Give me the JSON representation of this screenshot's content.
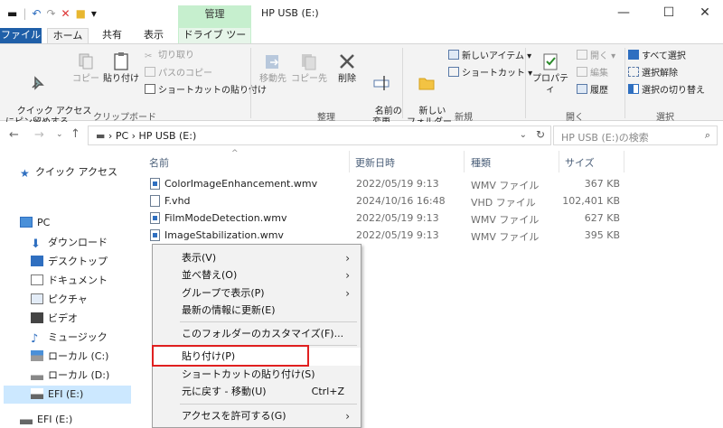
{
  "window": {
    "title": "HP USB (E:)",
    "context_tab": "管理",
    "controls": {
      "minimize": "—",
      "maximize": "☐",
      "close": "✕"
    }
  },
  "ribbon_tabs": [
    "ファイル",
    "ホーム",
    "共有",
    "表示",
    "ドライブ ツール"
  ],
  "ribbon": {
    "clipboard": {
      "pin": "クイック アクセス\nにピン留めする",
      "copy": "コピー",
      "paste": "貼り付け",
      "cut": "切り取り",
      "copy_path": "パスのコピー",
      "paste_shortcut": "ショートカットの貼り付け",
      "title": "クリップボード"
    },
    "organize": {
      "move_to": "移動先",
      "copy_to": "コピー先",
      "delete": "削除",
      "rename": "名前の\n変更",
      "title": "整理"
    },
    "new": {
      "new_folder": "新しい\nフォルダー",
      "new_item": "新しいアイテム ▾",
      "shortcut": "ショートカット ▾",
      "title": "新規"
    },
    "open": {
      "properties": "プロパティ",
      "open": "開く ▾",
      "edit": "編集",
      "history": "履歴",
      "title": "開く"
    },
    "select": {
      "select_all": "すべて選択",
      "select_none": "選択解除",
      "invert": "選択の切り替え",
      "title": "選択"
    }
  },
  "address": {
    "breadcrumb": "PC  ›  HP USB (E:)",
    "search_placeholder": "HP USB (E:)の検索"
  },
  "nav": {
    "quick_access": "クイック アクセス",
    "pc": "PC",
    "items": [
      "ダウンロード",
      "デスクトップ",
      "ドキュメント",
      "ピクチャ",
      "ビデオ",
      "ミュージック",
      "ローカル (C:)",
      "ローカル (D:)",
      "EFI (E:)",
      "EFI (E:)"
    ]
  },
  "columns": {
    "name": "名前",
    "date": "更新日時",
    "type": "種類",
    "size": "サイズ"
  },
  "files": [
    {
      "name": "ColorImageEnhancement.wmv",
      "date": "2022/05/19 9:13",
      "type": "WMV ファイル",
      "size": "367 KB"
    },
    {
      "name": "F.vhd",
      "date": "2024/10/16 16:48",
      "type": "VHD ファイル",
      "size": "102,401 KB"
    },
    {
      "name": "FilmModeDetection.wmv",
      "date": "2022/05/19 9:13",
      "type": "WMV ファイル",
      "size": "627 KB"
    },
    {
      "name": "ImageStabilization.wmv",
      "date": "2022/05/19 9:13",
      "type": "WMV ファイル",
      "size": "395 KB"
    }
  ],
  "context_menu": {
    "view": "表示(V)",
    "sort": "並べ替え(O)",
    "group": "グループで表示(P)",
    "refresh": "最新の情報に更新(E)",
    "customize": "このフォルダーのカスタマイズ(F)...",
    "paste": "貼り付け(P)",
    "paste_shortcut": "ショートカットの貼り付け(S)",
    "undo": "元に戻す - 移動(U)",
    "undo_shortcut": "Ctrl+Z",
    "access": "アクセスを許可する(G)"
  }
}
